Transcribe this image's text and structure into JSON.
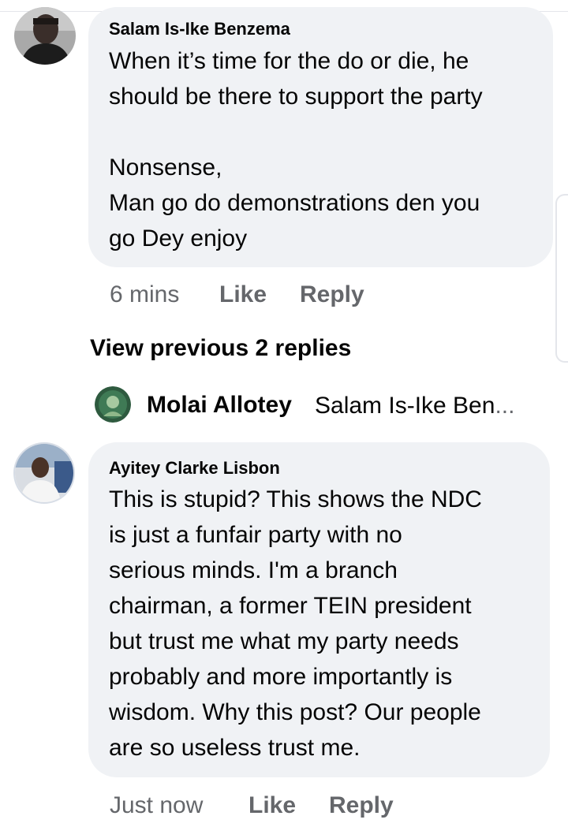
{
  "comments": [
    {
      "author": "Salam Is-Ike Benzema",
      "avatar_icon": "profile-photo-man-icon",
      "text": "When it’s time for the do or die, he\nshould be there to support the party\n\nNonsense,\nMan go do demonstrations den you\ngo Dey enjoy",
      "time": "6 mins",
      "like_label": "Like",
      "reply_label": "Reply"
    },
    {
      "author": "Ayitey Clarke Lisbon",
      "avatar_icon": "profile-photo-man-icon",
      "text": "This is stupid? This shows the NDC\nis just a funfair party with no\nserious minds. I'm a branch\nchairman, a former TEIN president\nbut trust me what my party needs\nprobably and more importantly is\nwisdom. Why this post? Our people\nare so useless trust me.",
      "time": "Just now",
      "like_label": "Like",
      "reply_label": "Reply"
    }
  ],
  "view_previous_replies": "View previous 2 replies",
  "latest_reply": {
    "author": "Molai Allotey",
    "preview": "Salam Is-Ike Ben",
    "ellipsis": "...",
    "avatar_icon": "profile-photo-icon"
  },
  "colors": {
    "bubble": "#f0f2f5",
    "text": "#050505",
    "secondary": "#65676b"
  }
}
